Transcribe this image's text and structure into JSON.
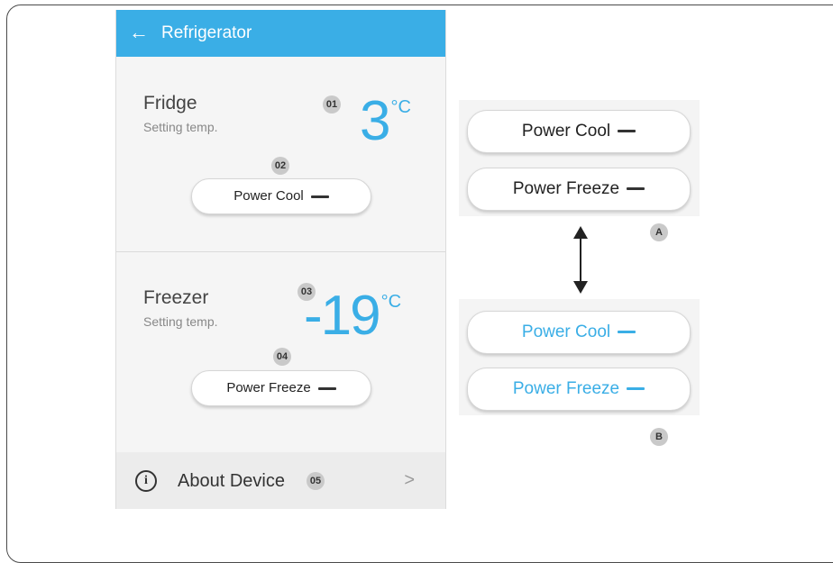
{
  "appbar": {
    "back_icon": "arrow-left-icon",
    "title": "Refrigerator"
  },
  "fridge": {
    "title": "Fridge",
    "subtitle": "Setting temp.",
    "temp": "3",
    "unit": "°C",
    "temp_badge": "01",
    "button_badge": "02",
    "button_label": "Power Cool"
  },
  "freezer": {
    "title": "Freezer",
    "subtitle": "Setting temp.",
    "temp": "-19",
    "unit": "°C",
    "temp_badge": "03",
    "button_badge": "04",
    "button_label": "Power Freeze"
  },
  "about": {
    "icon": "info-icon",
    "icon_glyph": "i",
    "label": "About Device",
    "badge": "05",
    "chevron": ">"
  },
  "legend_a": {
    "cool_label": "Power Cool",
    "freeze_label": "Power Freeze",
    "badge": "A",
    "state": "off",
    "color": "#222222"
  },
  "legend_b": {
    "cool_label": "Power Cool",
    "freeze_label": "Power Freeze",
    "badge": "B",
    "state": "on",
    "color": "#3aaee6"
  },
  "colors": {
    "accent": "#3aaee6",
    "appbar": "#3aaee6",
    "badge_bg": "#c9c9c9"
  }
}
